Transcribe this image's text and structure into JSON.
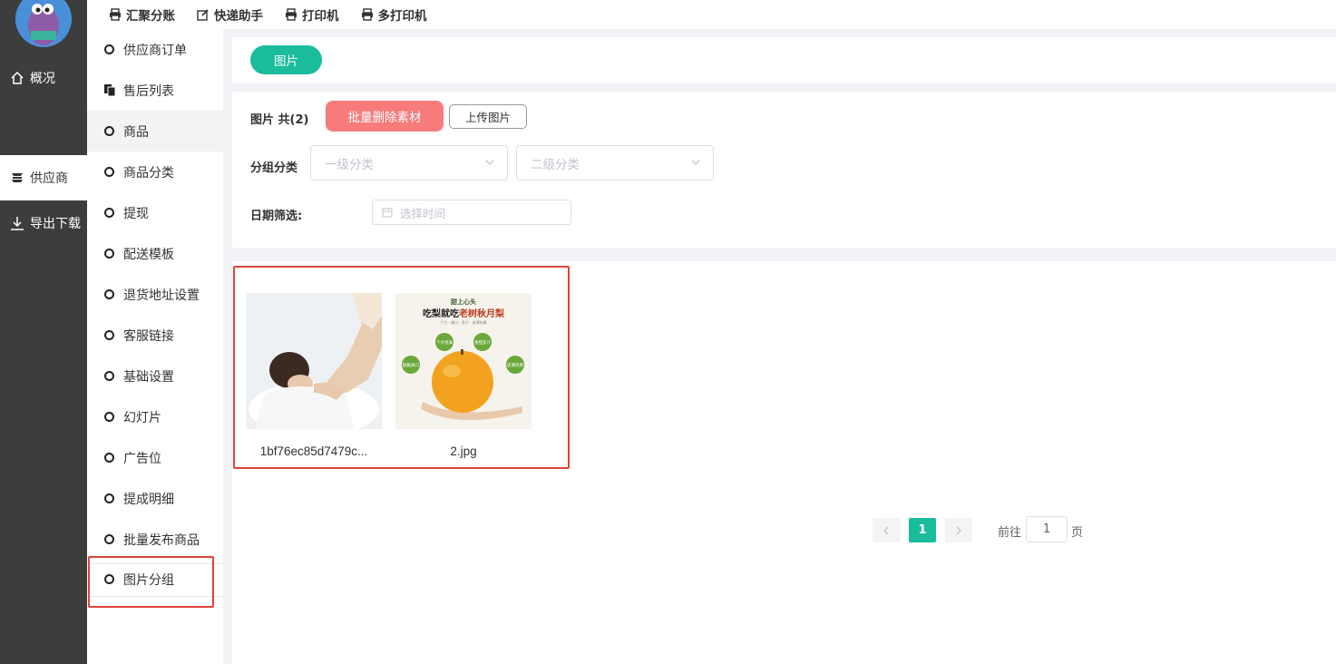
{
  "rail": {
    "items": [
      {
        "label": "概况",
        "icon": "home-icon"
      },
      {
        "label": "供应商",
        "icon": "supplier-icon"
      },
      {
        "label": "导出下载",
        "icon": "download-icon"
      }
    ],
    "active_index": 1
  },
  "topbar": {
    "items": [
      {
        "label": "汇聚分账",
        "icon": "print-icon"
      },
      {
        "label": "快递助手",
        "icon": "edit-icon"
      },
      {
        "label": "打印机",
        "icon": "print-icon"
      },
      {
        "label": "多打印机",
        "icon": "print-icon"
      }
    ]
  },
  "submenu": {
    "items": [
      {
        "label": "供应商订单"
      },
      {
        "label": "售后列表"
      },
      {
        "label": "商品"
      },
      {
        "label": "商品分类"
      },
      {
        "label": "提现"
      },
      {
        "label": "配送模板"
      },
      {
        "label": "退货地址设置"
      },
      {
        "label": "客服链接"
      },
      {
        "label": "基础设置"
      },
      {
        "label": "幻灯片"
      },
      {
        "label": "广告位"
      },
      {
        "label": "提成明细"
      },
      {
        "label": "批量发布商品"
      },
      {
        "label": "图片分组"
      }
    ],
    "active": "商品",
    "highlighted": "图片分组"
  },
  "tabs": {
    "active_label": "图片"
  },
  "filter": {
    "title": "图片 共(2)",
    "batch_delete_label": "批量删除素材",
    "upload_label": "上传图片",
    "group_label": "分组分类",
    "level1_placeholder": "一级分类",
    "level2_placeholder": "二级分类",
    "date_label": "日期筛选:",
    "date_placeholder": "选择时间"
  },
  "images": [
    {
      "name": "1bf76ec85d7479c...",
      "subject": "massage photo"
    },
    {
      "name": "2.jpg",
      "subject": "pear advertisement",
      "poster": {
        "brand": "甜上心头",
        "headline_a": "吃梨就吃",
        "headline_b": "老树秋月梨",
        "tagline": "个大 · 爽口 · 多汁 · 皮薄肉厚",
        "badges": [
          "个大饱满",
          "香甜多汁",
          "酥脆爽口",
          "皮薄肉厚"
        ]
      }
    }
  ],
  "pagination": {
    "current_page": "1",
    "goto_label": "前往",
    "goto_value": "1",
    "page_suffix": "页",
    "prev_icon": "chevron-left-icon",
    "next_icon": "chevron-right-icon"
  },
  "colors": {
    "accent": "#1abc9c",
    "danger": "#f77b7b",
    "highlight": "#e0443a",
    "rail_bg": "#3d3d3d"
  }
}
